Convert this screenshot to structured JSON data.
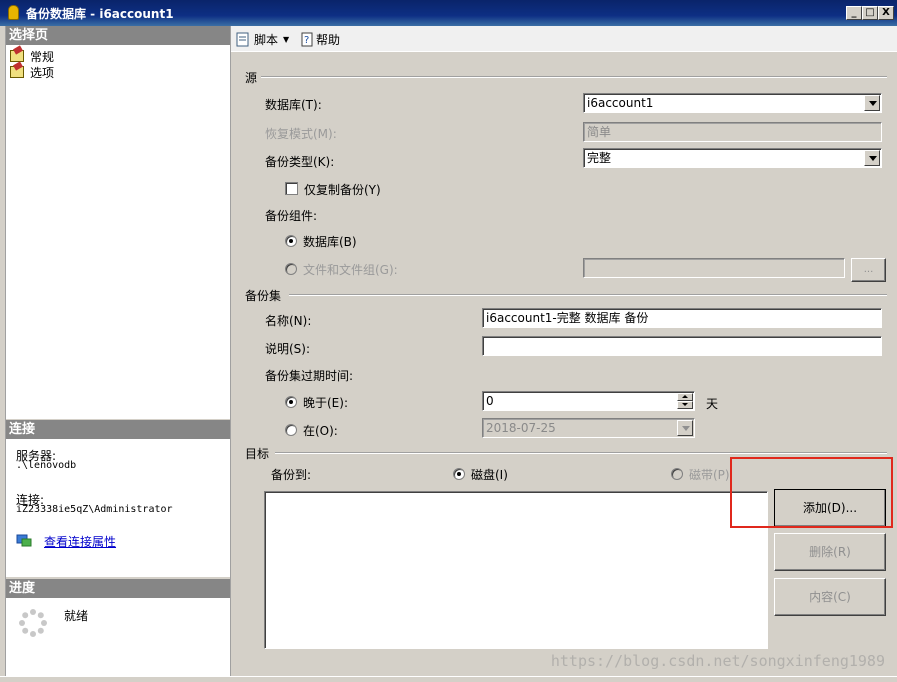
{
  "window": {
    "title": "备份数据库 - i6account1",
    "min": "_",
    "max": "□",
    "close": "X"
  },
  "left": {
    "pages_header": "选择页",
    "pages": [
      "常规",
      "选项"
    ],
    "connection_header": "连接",
    "server_label": "服务器:",
    "server_value": ".\\lenovodb",
    "conn_label": "连接:",
    "conn_value": "iZ23338ie5qZ\\Administrator",
    "view_conn_link": "查看连接属性",
    "progress_header": "进度",
    "progress_status": "就绪"
  },
  "toolbar": {
    "script": "脚本",
    "help": "帮助"
  },
  "source": {
    "title": "源",
    "db_label": "数据库(T):",
    "db_value": "i6account1",
    "recovery_label": "恢复模式(M):",
    "recovery_value": "简单",
    "backup_type_label": "备份类型(K):",
    "backup_type_value": "完整",
    "copy_only_label": "仅复制备份(Y)",
    "component_label": "备份组件:",
    "opt_database": "数据库(B)",
    "opt_files": "文件和文件组(G):",
    "browse": "..."
  },
  "backupset": {
    "title": "备份集",
    "name_label": "名称(N):",
    "name_value": "i6account1-完整 数据库 备份",
    "desc_label": "说明(S):",
    "desc_value": "",
    "expire_label": "备份集过期时间:",
    "after_label": "晚于(E):",
    "after_value": "0",
    "days": "天",
    "on_label": "在(O):",
    "on_value": "2018-07-25"
  },
  "target": {
    "title": "目标",
    "backup_to": "备份到:",
    "disk": "磁盘(I)",
    "tape": "磁带(P)",
    "add": "添加(D)...",
    "remove": "删除(R)",
    "contents": "内容(C)"
  },
  "watermark": "https://blog.csdn.net/songxinfeng1989",
  "colors": {
    "title_bar": "#0a246a",
    "section_header": "#868686",
    "highlight": "#e0281c",
    "link": "#0000cc"
  }
}
